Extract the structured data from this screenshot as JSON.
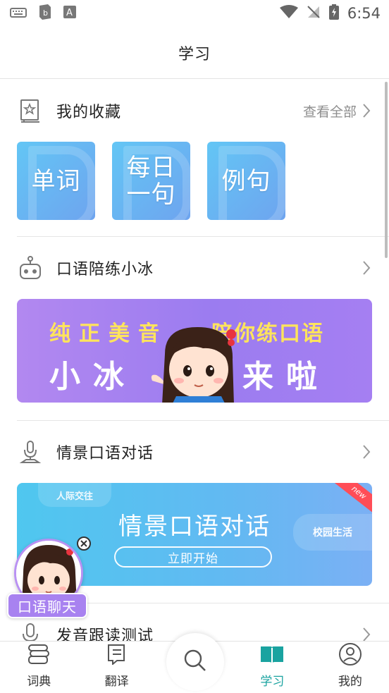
{
  "status_bar": {
    "time": "6:54",
    "icons": [
      "keyboard-icon",
      "app-badge-icon",
      "app-a-icon",
      "wifi-icon",
      "no-signal-icon",
      "battery-charging-icon"
    ]
  },
  "header": {
    "title": "学习"
  },
  "favorites": {
    "title": "我的收藏",
    "more_label": "查看全部",
    "tiles": [
      {
        "label": "单词"
      },
      {
        "label": "每日\n一句"
      },
      {
        "label": "例句"
      }
    ]
  },
  "xiaobing": {
    "title": "口语陪练小冰",
    "banner": {
      "line1_left": "纯正美音",
      "line1_right": "陪你练口语",
      "line2_left": "小冰",
      "line2_right": "来啦"
    }
  },
  "scene_dialog": {
    "title": "情景口语对话",
    "banner": {
      "title": "情景口语对话",
      "button": "立即开始",
      "tag_left": "人际交往",
      "tag_right": "校园生活",
      "badge": "new"
    }
  },
  "pronunciation": {
    "title": "发音跟读测试"
  },
  "floating_chat": {
    "label": "口语聊天"
  },
  "bottom_nav": {
    "items": [
      {
        "label": "词典",
        "icon": "dictionary-icon",
        "active": false
      },
      {
        "label": "翻译",
        "icon": "translate-icon",
        "active": false
      },
      {
        "label": "学习",
        "icon": "book-icon",
        "active": true
      },
      {
        "label": "我的",
        "icon": "profile-icon",
        "active": false
      }
    ],
    "search_icon": "search-icon"
  },
  "colors": {
    "accent": "#1aa3a0",
    "tile_gradient": "#63c6f5",
    "banner_purple": "#9b7cf0",
    "banner_blue": "#4fc7ef"
  }
}
